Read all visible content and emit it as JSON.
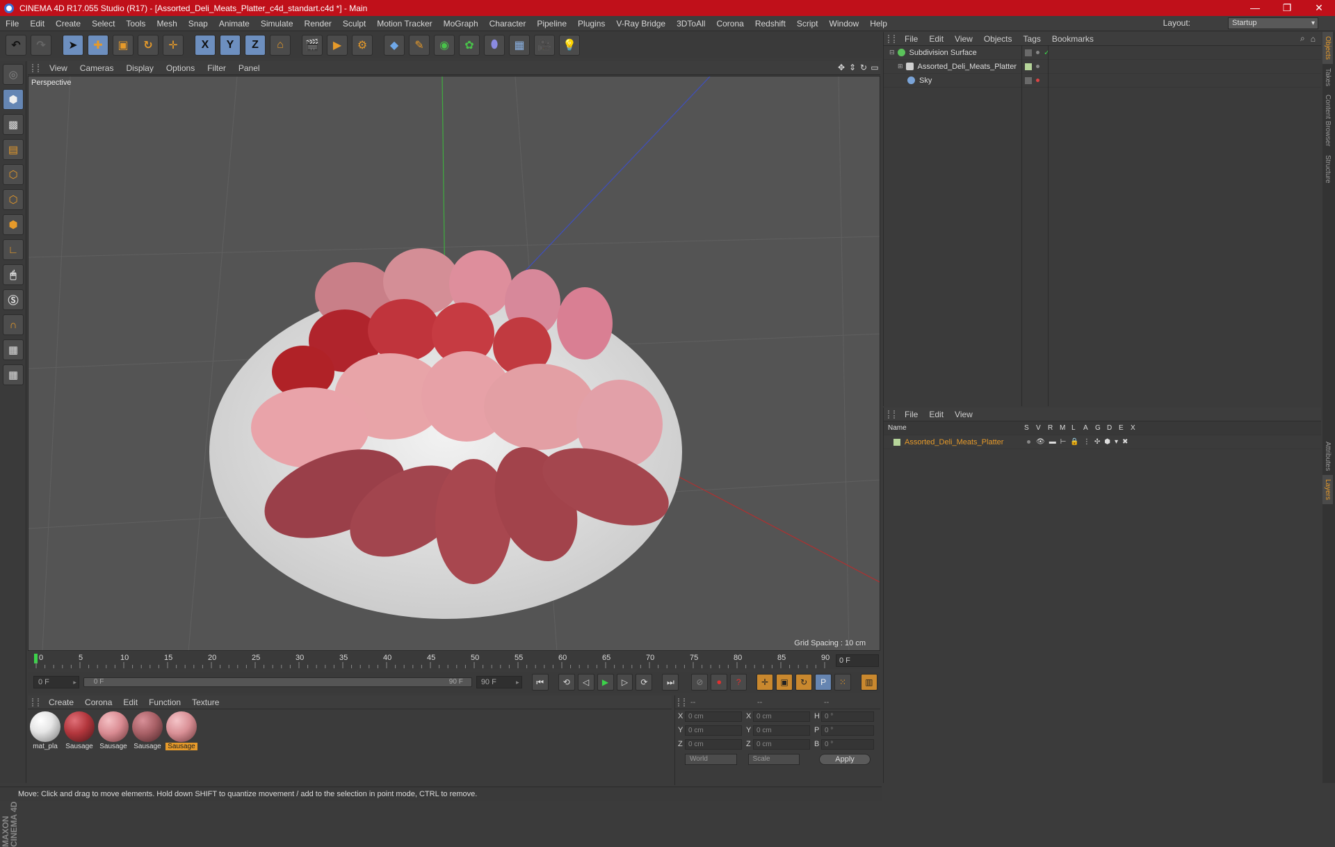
{
  "window": {
    "title": "CINEMA 4D R17.055 Studio (R17) - [Assorted_Deli_Meats_Platter_c4d_standart.c4d *] - Main",
    "min": "—",
    "max": "❐",
    "close": "✕"
  },
  "menu": [
    "File",
    "Edit",
    "Create",
    "Select",
    "Tools",
    "Mesh",
    "Snap",
    "Animate",
    "Simulate",
    "Render",
    "Sculpt",
    "Motion Tracker",
    "MoGraph",
    "Character",
    "Pipeline",
    "Plugins",
    "V-Ray Bridge",
    "3DToAll",
    "Corona",
    "Redshift",
    "Script",
    "Window",
    "Help"
  ],
  "layout": {
    "label": "Layout:",
    "value": "Startup"
  },
  "toolbar": {
    "x": "X",
    "y": "Y",
    "z": "Z"
  },
  "viewport": {
    "menu": [
      "View",
      "Cameras",
      "Display",
      "Options",
      "Filter",
      "Panel"
    ],
    "label": "Perspective",
    "grid_spacing": "Grid Spacing : 10 cm"
  },
  "timeline": {
    "ticks": [
      "0",
      "5",
      "10",
      "15",
      "20",
      "25",
      "30",
      "35",
      "40",
      "45",
      "50",
      "55",
      "60",
      "65",
      "70",
      "75",
      "80",
      "85",
      "90"
    ],
    "frame": "0 F"
  },
  "transport": {
    "start": "0 F",
    "slider_start": "0 F",
    "slider_end": "90 F",
    "end": "90 F"
  },
  "materials": {
    "menu": [
      "Create",
      "Corona",
      "Edit",
      "Function",
      "Texture"
    ],
    "items": [
      {
        "label": "mat_pla",
        "color": "#e6e6e6"
      },
      {
        "label": "Sausage",
        "color": "#b2363c"
      },
      {
        "label": "Sausage",
        "color": "#d98b92"
      },
      {
        "label": "Sausage",
        "color": "#a86066"
      },
      {
        "label": "Sausage",
        "color": "#d99096"
      }
    ]
  },
  "coords": {
    "header": [
      "--",
      "--",
      "--"
    ],
    "rows": [
      {
        "a1": "X",
        "v1": "0 cm",
        "a2": "X",
        "v2": "0 cm",
        "a3": "H",
        "v3": "0 °"
      },
      {
        "a1": "Y",
        "v1": "0 cm",
        "a2": "Y",
        "v2": "0 cm",
        "a3": "P",
        "v3": "0 °"
      },
      {
        "a1": "Z",
        "v1": "0 cm",
        "a2": "Z",
        "v2": "0 cm",
        "a3": "B",
        "v3": "0 °"
      }
    ],
    "world": "World",
    "scale": "Scale",
    "apply": "Apply"
  },
  "status": "Move: Click and drag to move elements. Hold down SHIFT to quantize movement / add to the selection in point mode, CTRL to remove.",
  "objects": {
    "menu": [
      "File",
      "Edit",
      "View",
      "Objects",
      "Tags",
      "Bookmarks"
    ],
    "items": [
      {
        "name": "Subdivision Surface",
        "color": "#5bc25b"
      },
      {
        "name": "Assorted_Deli_Meats_Platter",
        "color": "#d0d0d0"
      },
      {
        "name": "Sky",
        "color": "#7aa4d8"
      }
    ]
  },
  "layers": {
    "menu": [
      "File",
      "Edit",
      "View"
    ],
    "columns": [
      "Name",
      "S",
      "V",
      "R",
      "M",
      "L",
      "A",
      "G",
      "D",
      "E",
      "X"
    ],
    "items": [
      {
        "name": "Assorted_Deli_Meats_Platter"
      }
    ]
  },
  "sidetabs": [
    "Objects",
    "Takes",
    "Content Browser",
    "Structure",
    "Attributes",
    "Layers"
  ],
  "brand": "MAXON CINEMA 4D"
}
